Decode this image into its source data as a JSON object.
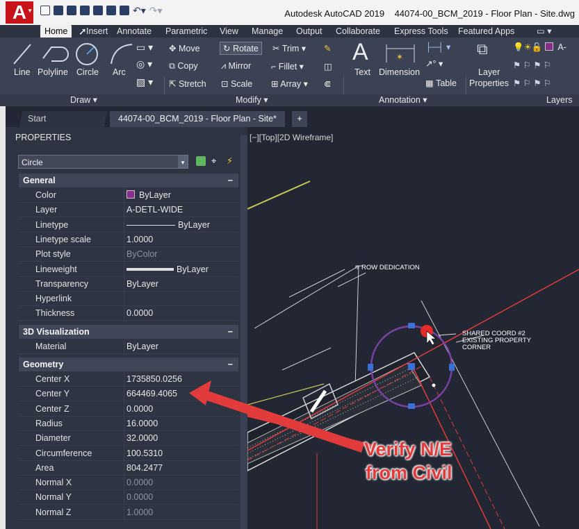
{
  "app": {
    "logo": "A",
    "title": "Autodesk AutoCAD 2019    44074-00_BCM_2019 - Floor Plan - Site.dwg"
  },
  "ribbon_tabs": [
    "Home",
    "Insert",
    "Annotate",
    "Parametric",
    "View",
    "Manage",
    "Output",
    "Collaborate",
    "Express Tools",
    "Featured Apps"
  ],
  "ribbon": {
    "draw": {
      "line": "Line",
      "polyline": "Polyline",
      "circle": "Circle",
      "arc": "Arc",
      "title": "Draw"
    },
    "modify": {
      "move": "Move",
      "rotate": "Rotate",
      "trim": "Trim",
      "copy": "Copy",
      "mirror": "Mirror",
      "fillet": "Fillet",
      "stretch": "Stretch",
      "scale": "Scale",
      "array": "Array",
      "title": "Modify"
    },
    "annotation": {
      "text": "Text",
      "dimension": "Dimension",
      "table": "Table",
      "title": "Annotation"
    },
    "layers": {
      "layer_properties": "Layer Properties",
      "title": "Layers",
      "layer_prefix": "A-"
    }
  },
  "doc_tabs": {
    "start": "Start",
    "doc": "44074-00_BCM_2019 - Floor Plan - Site*",
    "close": "×",
    "plus": "+"
  },
  "properties": {
    "header": "PROPERTIES",
    "object_type": "Circle",
    "sections": {
      "general": "General",
      "viz": "3D Visualization",
      "geometry": "Geometry"
    },
    "general": [
      {
        "k": "Color",
        "v": "ByLayer"
      },
      {
        "k": "Layer",
        "v": "A-DETL-WIDE"
      },
      {
        "k": "Linetype",
        "v": "ByLayer"
      },
      {
        "k": "Linetype scale",
        "v": "1.0000"
      },
      {
        "k": "Plot style",
        "v": "ByColor"
      },
      {
        "k": "Lineweight",
        "v": "ByLayer"
      },
      {
        "k": "Transparency",
        "v": "ByLayer"
      },
      {
        "k": "Hyperlink",
        "v": ""
      },
      {
        "k": "Thickness",
        "v": "0.0000"
      }
    ],
    "viz": [
      {
        "k": "Material",
        "v": "ByLayer"
      }
    ],
    "geometry": [
      {
        "k": "Center X",
        "v": "1735850.0256"
      },
      {
        "k": "Center Y",
        "v": "664469.4065"
      },
      {
        "k": "Center Z",
        "v": "0.0000"
      },
      {
        "k": "Radius",
        "v": "16.0000"
      },
      {
        "k": "Diameter",
        "v": "32.0000"
      },
      {
        "k": "Circumference",
        "v": "100.5310"
      },
      {
        "k": "Area",
        "v": "804.2477"
      },
      {
        "k": "Normal X",
        "v": "0.0000"
      },
      {
        "k": "Normal Y",
        "v": "0.0000"
      },
      {
        "k": "Normal Z",
        "v": "1.0000"
      }
    ]
  },
  "viewport": {
    "label": "[−][Top][2D Wireframe]",
    "row_dedication": "ROW DEDICATION",
    "shared_coord": [
      "SHARED COORD #2",
      "EXISTING PROPERTY",
      "CORNER"
    ]
  },
  "callout": {
    "line1": "Verify N/E",
    "line2": "from Civil",
    "color": "#e13b3b"
  }
}
